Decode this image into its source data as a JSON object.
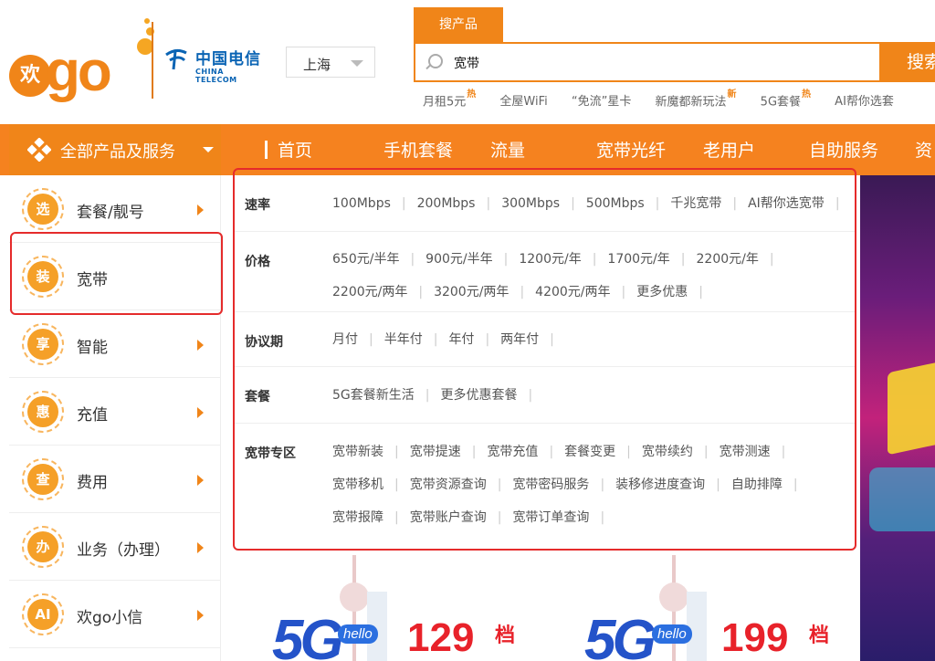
{
  "header": {
    "logo_badge": "欢",
    "logo_text": "go",
    "telecom_cn": "中国电信",
    "telecom_en": "CHINA TELECOM",
    "city": "上海",
    "search_tab": "搜产品",
    "search_value": "宽带",
    "search_button": "搜索",
    "hot_links": [
      {
        "label": "月租5元",
        "tag": "热"
      },
      {
        "label": "全屋WiFi",
        "tag": ""
      },
      {
        "label": "“免流”星卡",
        "tag": ""
      },
      {
        "label": "新魔都新玩法",
        "tag": "新"
      },
      {
        "label": "5G套餐",
        "tag": "热"
      },
      {
        "label": "AI帮你选套",
        "tag": ""
      }
    ]
  },
  "nav": {
    "all_products": "全部产品及服务",
    "items": [
      "首页",
      "手机套餐",
      "流量",
      "宽带光纤",
      "老用户",
      "自助服务",
      "资"
    ]
  },
  "categories": [
    {
      "badge": "选",
      "label": "套餐/靓号"
    },
    {
      "badge": "装",
      "label": "宽带"
    },
    {
      "badge": "享",
      "label": "智能"
    },
    {
      "badge": "惠",
      "label": "充值"
    },
    {
      "badge": "查",
      "label": "费用"
    },
    {
      "badge": "办",
      "label": "业务（办理）"
    },
    {
      "badge": "AI",
      "label": "欢go小信"
    }
  ],
  "panel": {
    "rows": [
      {
        "title": "速率",
        "links": [
          "100Mbps",
          "200Mbps",
          "300Mbps",
          "500Mbps",
          "千兆宽带",
          "AI帮你选宽带"
        ]
      },
      {
        "title": "价格",
        "links": [
          "650元/半年",
          "900元/半年",
          "1200元/年",
          "1700元/年",
          "2200元/年",
          "2200元/两年",
          "3200元/两年",
          "4200元/两年",
          "更多优惠"
        ]
      },
      {
        "title": "协议期",
        "links": [
          "月付",
          "半年付",
          "年付",
          "两年付"
        ]
      },
      {
        "title": "套餐",
        "links": [
          "5G套餐新生活",
          "更多优惠套餐"
        ]
      },
      {
        "title": "宽带专区",
        "links": [
          "宽带新装",
          "宽带提速",
          "宽带充值",
          "套餐变更",
          "宽带续约",
          "宽带测速",
          "宽带移机",
          "宽带资源查询",
          "宽带密码服务",
          "装移修进度查询",
          "自助排障",
          "宽带报障",
          "宽带账户查询",
          "宽带订单查询"
        ]
      }
    ]
  },
  "promo": {
    "items": [
      {
        "label_5g": "5G",
        "hello": "hello",
        "price": "129",
        "unit": "档"
      },
      {
        "label_5g": "5G",
        "hello": "hello",
        "price": "199",
        "unit": "档"
      }
    ]
  },
  "colors": {
    "brand_orange": "#f08519",
    "annotation_red": "#e52b2b",
    "telecom_blue": "#0a64b4"
  },
  "icons": {
    "search": "search-icon",
    "caret": "chevron-down-icon",
    "arrow": "chevron-right-icon",
    "all_products": "diamond-grid-icon"
  }
}
